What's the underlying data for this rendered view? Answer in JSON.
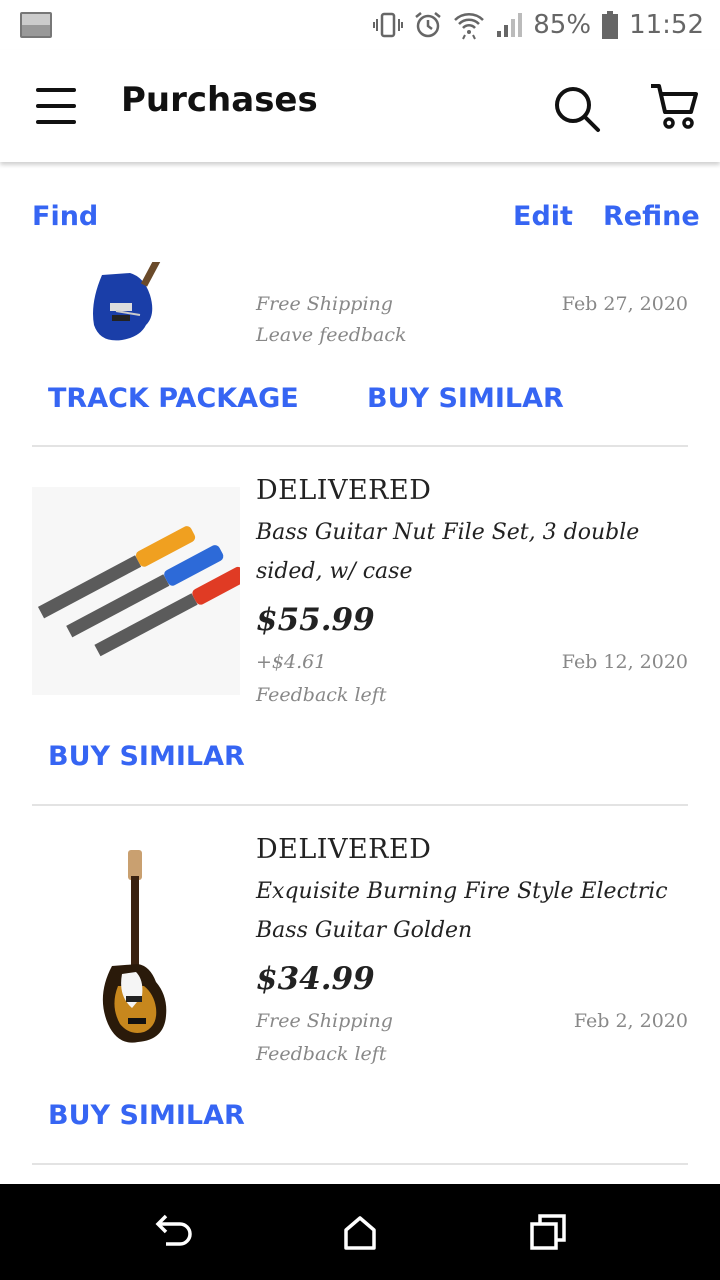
{
  "status_bar": {
    "battery": "85%",
    "time": "11:52",
    "icons": [
      "gallery-icon",
      "vibrate-icon",
      "alarm-icon",
      "wifi-icon",
      "signal-icon",
      "battery-icon"
    ]
  },
  "app_bar": {
    "title": "Purchases",
    "icons": [
      "menu-icon",
      "search-icon",
      "cart-icon"
    ]
  },
  "toolbar": {
    "find": "Find",
    "edit": "Edit",
    "refine": "Refine"
  },
  "purchases": [
    {
      "thumb_icon": "blue-bass-guitar-image",
      "shipping": "Free Shipping",
      "feedback": "Leave feedback",
      "date": "Feb 27, 2020",
      "track_label": "TRACK PACKAGE",
      "buy_label": "BUY SIMILAR"
    },
    {
      "thumb_icon": "nut-file-set-image",
      "status": "DELIVERED",
      "title": "Bass Guitar Nut File Set, 3 double sided, w/ case",
      "price": "$55.99",
      "shipping": "+$4.61",
      "date": "Feb 12, 2020",
      "feedback": "Feedback left",
      "buy_label": "BUY SIMILAR"
    },
    {
      "thumb_icon": "sunburst-bass-guitar-image",
      "status": "DELIVERED",
      "title": "Exquisite Burning Fire Style Electric Bass Guitar Golden",
      "price": "$34.99",
      "shipping": "Free Shipping",
      "date": "Feb 2, 2020",
      "feedback": "Feedback left",
      "buy_label": "BUY SIMILAR"
    }
  ],
  "nav_bar": {
    "icons": [
      "back-icon",
      "home-icon",
      "recents-icon"
    ]
  },
  "colors": {
    "accent": "#3665f3",
    "text": "#222222",
    "muted": "#888888",
    "nav_bg": "#000000"
  }
}
